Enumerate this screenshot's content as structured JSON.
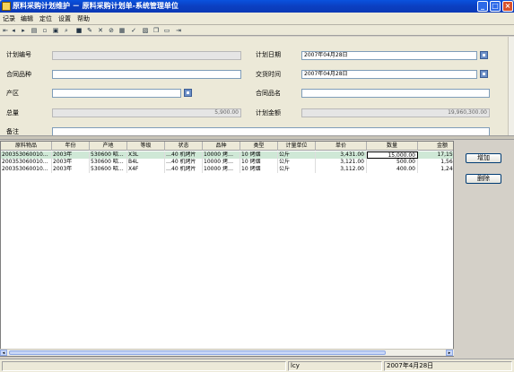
{
  "window": {
    "title": "原料采购计划维护 － 原料采购计划单-系统管理单位"
  },
  "menu": [
    "记录",
    "编辑",
    "定位",
    "设置",
    "帮助"
  ],
  "toolbar_icons": [
    "first-icon",
    "prev-icon",
    "next-icon",
    "preview-icon",
    "new-icon",
    "open-icon",
    "find-icon",
    "save-icon",
    "edit-icon",
    "delete-icon",
    "cancel-icon",
    "refresh-icon",
    "approve-icon",
    "unapprove-icon",
    "copy-icon",
    "print-icon",
    "export-icon"
  ],
  "form": {
    "plan_no": {
      "label": "计划编号",
      "value": ""
    },
    "plan_date": {
      "label": "计划日期",
      "value": "2007年04月28日"
    },
    "contract_variety": {
      "label": "合同品种",
      "value": ""
    },
    "delivery_time": {
      "label": "交货时间",
      "value": "2007年04月28日"
    },
    "origin": {
      "label": "产区",
      "value": ""
    },
    "contract_product": {
      "label": "合同品名",
      "value": ""
    },
    "total_qty": {
      "label": "总量",
      "value": "5,900.00"
    },
    "plan_amount": {
      "label": "计划金额",
      "value": "19,960,300.00"
    },
    "remark": {
      "label": "备注",
      "value": ""
    }
  },
  "grid": {
    "columns": [
      "原料物品",
      "年份",
      "产地",
      "等级",
      "状态",
      "品种",
      "类型",
      "计量单位",
      "单价",
      "数量",
      "金额"
    ],
    "rows": [
      [
        "200353060010…",
        "2003年",
        "530600 昭…",
        "X3L",
        "…40 机烤片",
        "10000 烤…",
        "10 烤烟",
        "公斤",
        "3,431.00",
        "15,000.00",
        "17,155,00"
      ],
      [
        "200353060010…",
        "2003年",
        "530600 昭…",
        "B4L",
        "…40 机烤片",
        "10000 烤…",
        "10 烤烟",
        "公斤",
        "3,121.00",
        "500.00",
        "1,560,50"
      ],
      [
        "200353060010…",
        "2003年",
        "530600 昭…",
        "X4F",
        "…40 机烤片",
        "10000 烤…",
        "10 烤烟",
        "公斤",
        "3,112.00",
        "400.00",
        "1,244,80"
      ]
    ]
  },
  "buttons": {
    "add": "增加",
    "delete": "删除"
  },
  "status": {
    "user": "lcy",
    "date": "2007年4月28日"
  },
  "colors": {
    "title": "#0a46cc",
    "selected_row": "#cfe8d6",
    "field_border": "#7f9db9"
  }
}
